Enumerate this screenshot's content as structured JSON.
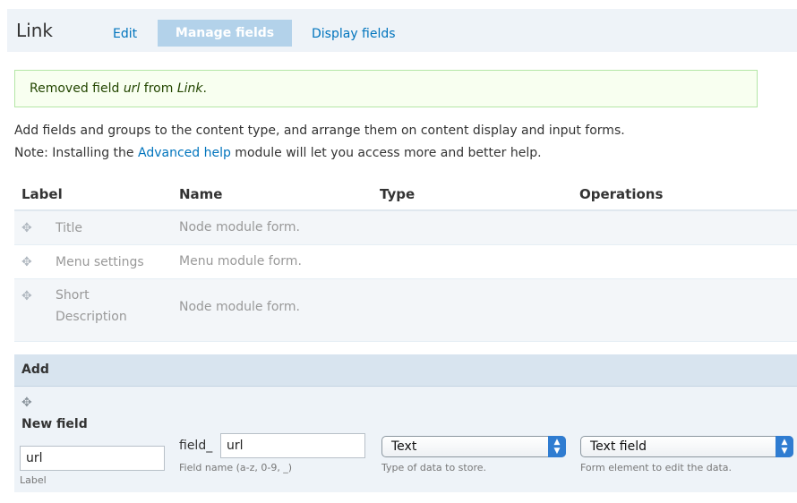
{
  "header": {
    "title": "Link",
    "tabs": [
      {
        "label": "Edit"
      },
      {
        "label": "Manage fields"
      },
      {
        "label": "Display fields"
      }
    ]
  },
  "message": {
    "prefix": "Removed field ",
    "field": "url",
    "middle": " from ",
    "type": "Link",
    "suffix": "."
  },
  "help": {
    "line1": "Add fields and groups to the content type, and arrange them on content display and input forms.",
    "line2_prefix": "Note: Installing the ",
    "line2_link": "Advanced help",
    "line2_suffix": " module will let you access more and better help."
  },
  "table": {
    "headers": [
      "Label",
      "Name",
      "Type",
      "Operations"
    ],
    "rows": [
      {
        "label": "Title",
        "name": "Node module form."
      },
      {
        "label": "Menu settings",
        "name": "Menu module form."
      },
      {
        "label": "Short Description",
        "name": "Node module form."
      }
    ]
  },
  "add": {
    "heading": "Add",
    "new_field_title": "New field",
    "label_value": "url",
    "label_caption": "Label",
    "field_prefix": "field_",
    "field_value": "url",
    "field_caption": "Field name (a-z, 0-9, _)",
    "type_selected": "Text",
    "type_caption": "Type of data to store.",
    "widget_selected": "Text field",
    "widget_caption": "Form element to edit the data."
  },
  "icons": {
    "drag": "move-cross-icon",
    "select_arrow": "up-down-arrow-icon"
  },
  "colors": {
    "link": "#0074bd",
    "active_tab_bg": "#b3d2ea",
    "status_border": "#b4e6a6"
  }
}
